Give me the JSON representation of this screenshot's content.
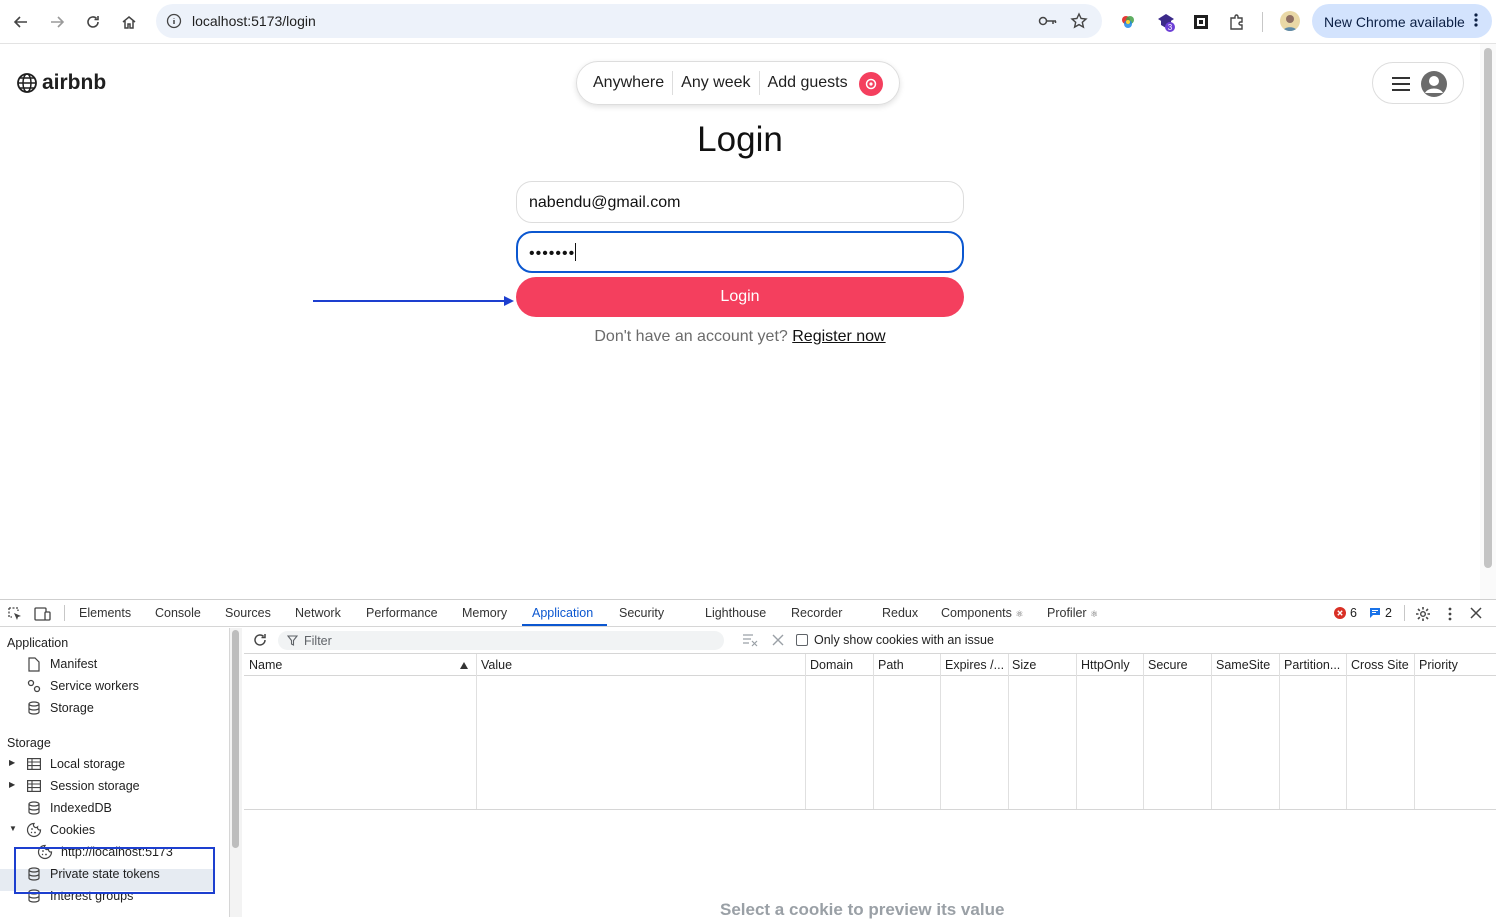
{
  "browser": {
    "url": "localhost:5173/login",
    "new_chrome_label": "New Chrome available",
    "extension_badge": "3"
  },
  "page": {
    "logo_text": "airbnb",
    "search": {
      "where": "Anywhere",
      "when": "Any week",
      "who": "Add guests"
    },
    "title": "Login",
    "email_value": "nabendu@gmail.com",
    "password_mask": "•••••••",
    "login_label": "Login",
    "register_prompt": "Don't have an account yet?",
    "register_link": "Register now"
  },
  "devtools": {
    "tabs": [
      "Elements",
      "Console",
      "Sources",
      "Network",
      "Performance",
      "Memory",
      "Application",
      "Security",
      "Lighthouse",
      "Recorder",
      "Redux",
      "Components",
      "Profiler"
    ],
    "active_tab": "Application",
    "error_count": "6",
    "message_count": "2",
    "sidebar": {
      "application_header": "Application",
      "application_items": [
        "Manifest",
        "Service workers",
        "Storage"
      ],
      "storage_header": "Storage",
      "storage_items": [
        "Local storage",
        "Session storage",
        "IndexedDB",
        "Cookies"
      ],
      "cookie_origin": "http://localhost:5173",
      "more_items": [
        "Private state tokens",
        "Interest groups"
      ]
    },
    "toolbar": {
      "filter_placeholder": "Filter",
      "only_issue_label": "Only show cookies with an issue"
    },
    "columns": [
      "Name",
      "Value",
      "Domain",
      "Path",
      "Expires /...",
      "Size",
      "HttpOnly",
      "Secure",
      "SameSite",
      "Partition...",
      "Cross Site",
      "Priority"
    ],
    "preview_hint": "Select a cookie to preview its value"
  },
  "colors": {
    "brand": "#f43f5e",
    "devtools_accent": "#0b57d0",
    "annotation": "#1d3fcf"
  }
}
